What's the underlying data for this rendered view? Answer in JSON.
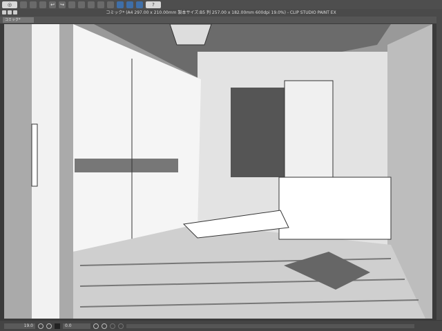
{
  "app": {
    "title": "コミック* (A4 297.00 x 210.00mm 製本サイズ:B5 判 257.00 x 182.00mm 600dpi 19.0%) - CLIP STUDIO PAINT EX"
  },
  "tabs": [
    {
      "label": "コミック*"
    }
  ],
  "toolbar": {
    "help_label": "?"
  },
  "status": {
    "zoom": "19.0",
    "rotation": "0.0"
  },
  "colors": {
    "accent": "#3f6fa8"
  }
}
